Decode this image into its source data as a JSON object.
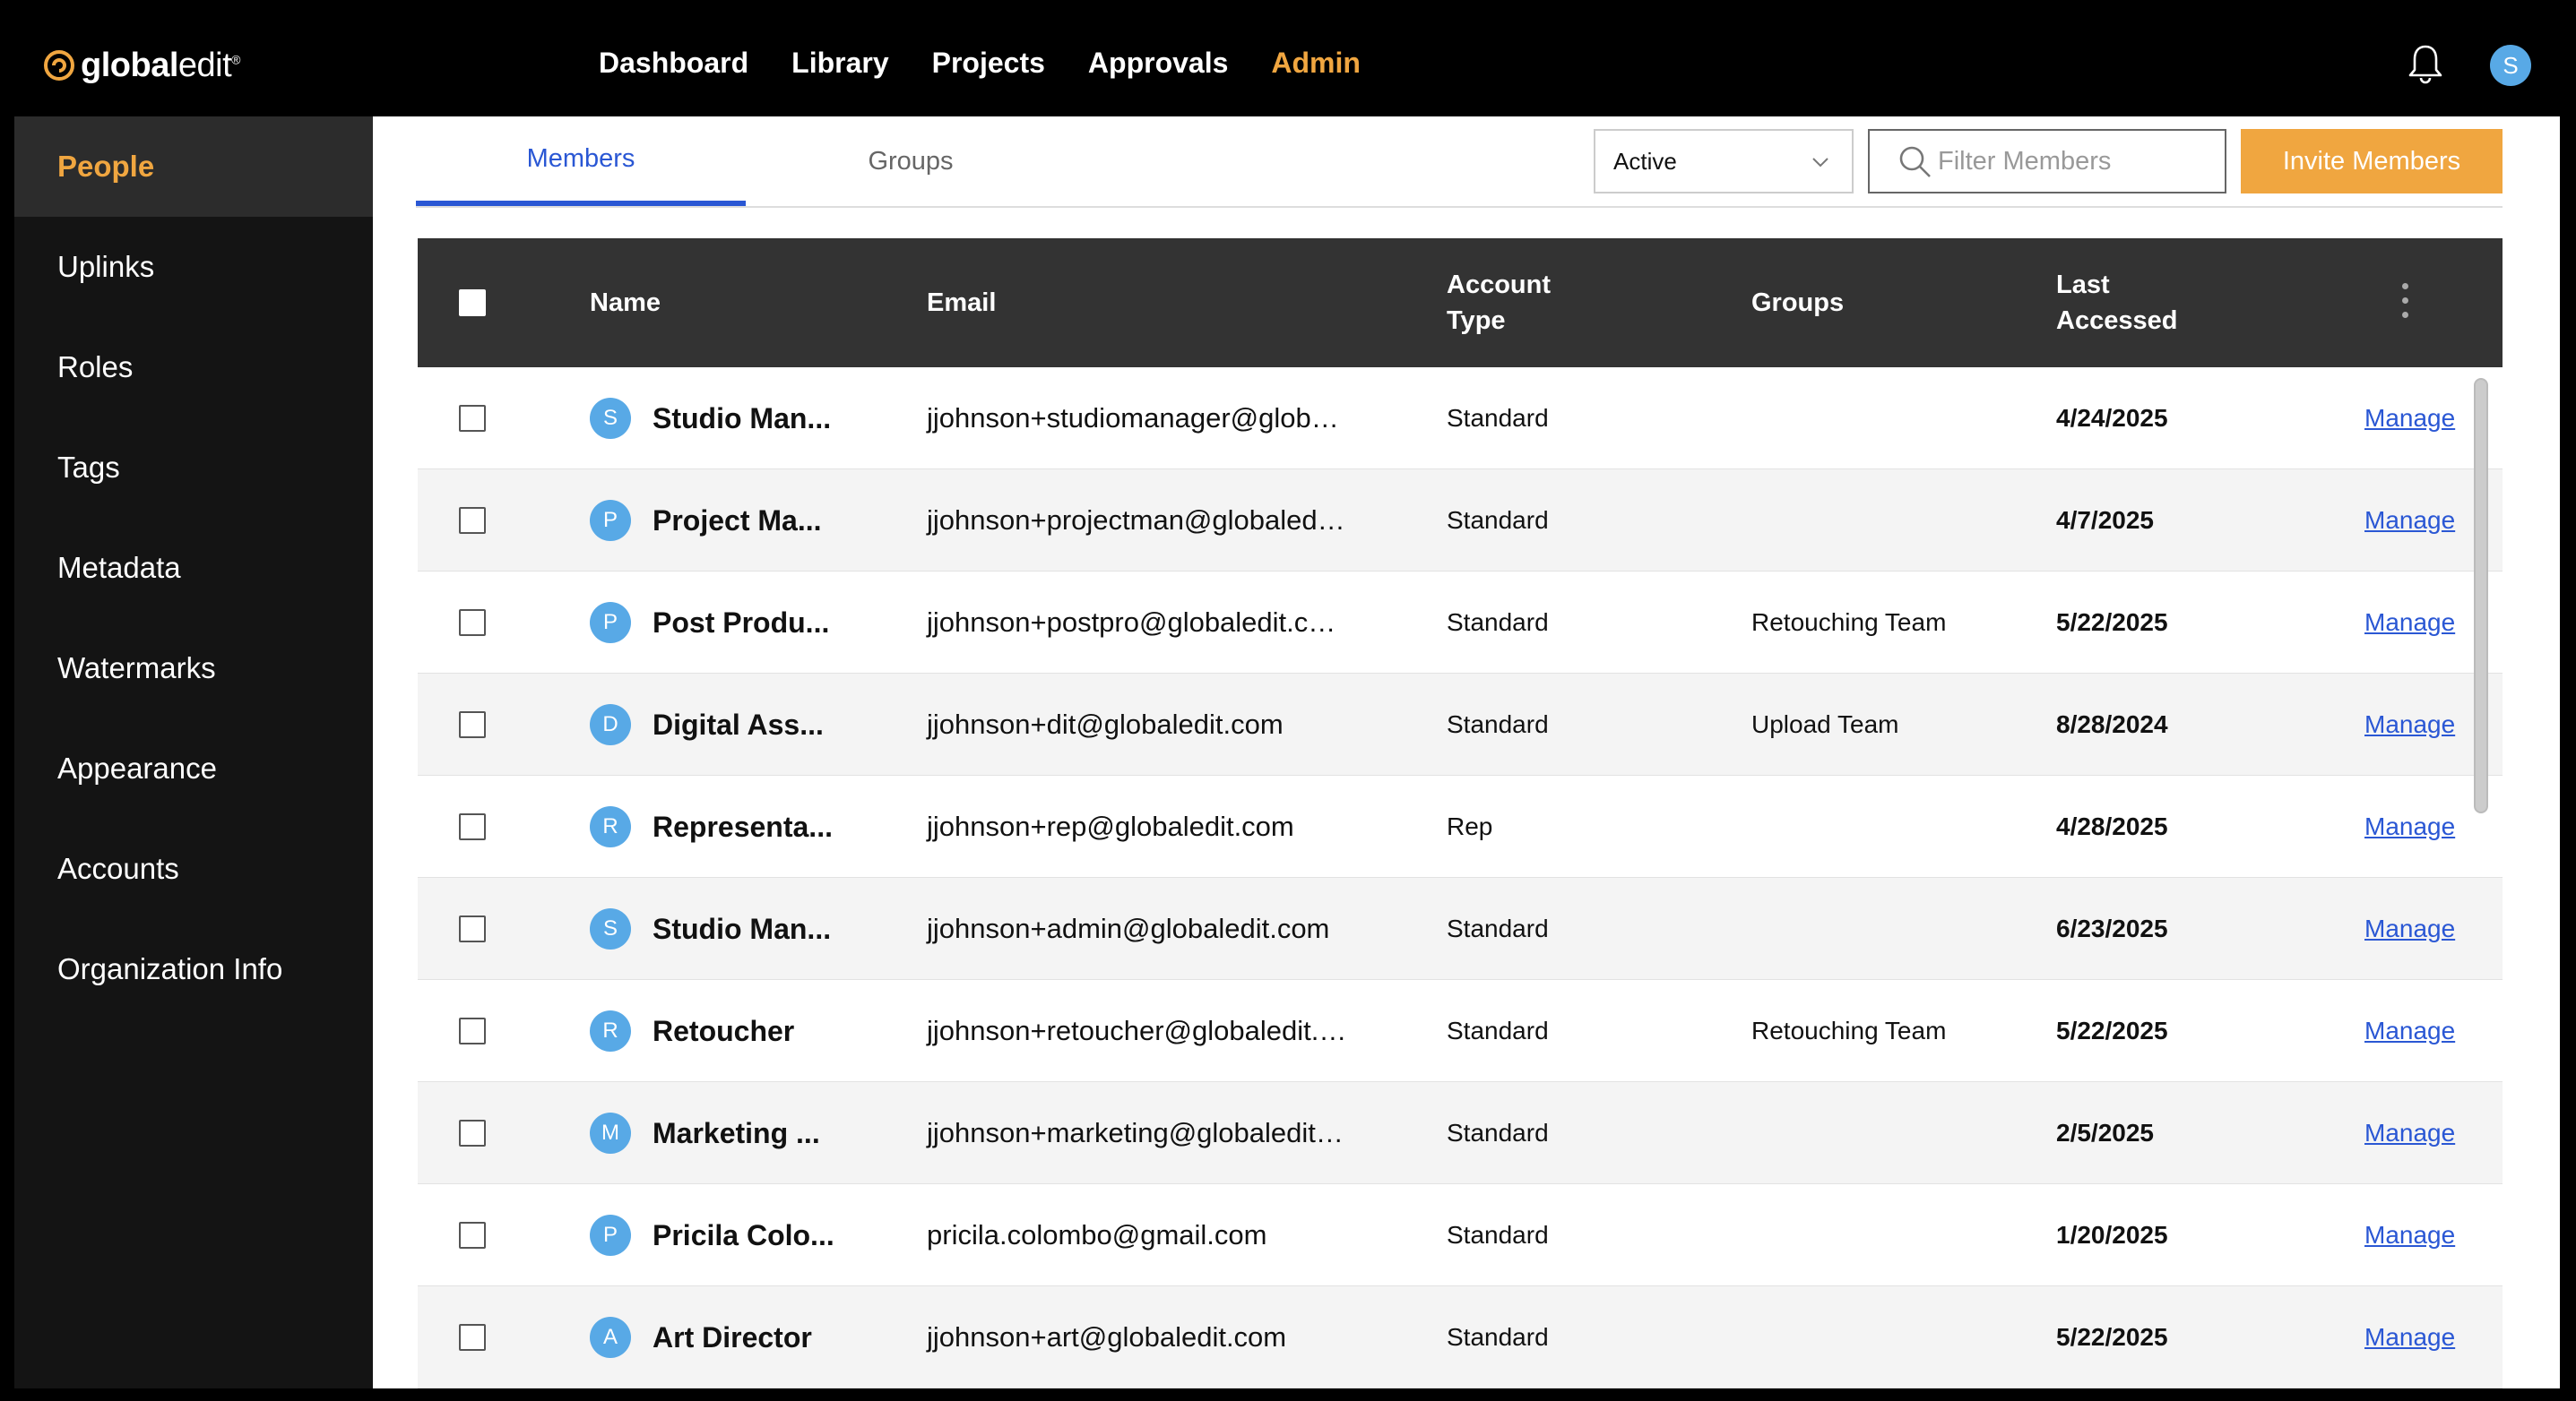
{
  "brand": {
    "bold": "global",
    "light": "edit",
    "mark": "®"
  },
  "nav": [
    {
      "label": "Dashboard"
    },
    {
      "label": "Library"
    },
    {
      "label": "Projects"
    },
    {
      "label": "Approvals"
    },
    {
      "label": "Admin"
    }
  ],
  "user": {
    "initial": "S"
  },
  "sidebar": [
    {
      "label": "People"
    },
    {
      "label": "Uplinks"
    },
    {
      "label": "Roles"
    },
    {
      "label": "Tags"
    },
    {
      "label": "Metadata"
    },
    {
      "label": "Watermarks"
    },
    {
      "label": "Appearance"
    },
    {
      "label": "Accounts"
    },
    {
      "label": "Organization Info"
    }
  ],
  "tabs": {
    "members": "Members",
    "groups": "Groups"
  },
  "status_select": {
    "value": "Active"
  },
  "filter": {
    "placeholder": "Filter Members",
    "value": ""
  },
  "invite_label": "Invite Members",
  "columns": {
    "name": "Name",
    "email": "Email",
    "type_line1": "Account",
    "type_line2": "Type",
    "groups": "Groups",
    "last_line1": "Last",
    "last_line2": "Accessed"
  },
  "rows": [
    {
      "initial": "S",
      "name": "Studio Man...",
      "email": "jjohnson+studiomanager@glob…",
      "type": "Standard",
      "groups": "",
      "last": "4/24/2025",
      "action": "Manage"
    },
    {
      "initial": "P",
      "name": "Project Ma...",
      "email": "jjohnson+projectman@globaled…",
      "type": "Standard",
      "groups": "",
      "last": "4/7/2025",
      "action": "Manage"
    },
    {
      "initial": "P",
      "name": "Post Produ...",
      "email": "jjohnson+postpro@globaledit.c…",
      "type": "Standard",
      "groups": "Retouching Team",
      "last": "5/22/2025",
      "action": "Manage"
    },
    {
      "initial": "D",
      "name": "Digital Ass...",
      "email": "jjohnson+dit@globaledit.com",
      "type": "Standard",
      "groups": "Upload Team",
      "last": "8/28/2024",
      "action": "Manage"
    },
    {
      "initial": "R",
      "name": "Representa...",
      "email": "jjohnson+rep@globaledit.com",
      "type": "Rep",
      "groups": "",
      "last": "4/28/2025",
      "action": "Manage"
    },
    {
      "initial": "S",
      "name": "Studio Man...",
      "email": "jjohnson+admin@globaledit.com",
      "type": "Standard",
      "groups": "",
      "last": "6/23/2025",
      "action": "Manage"
    },
    {
      "initial": "R",
      "name": "Retoucher",
      "email": "jjohnson+retoucher@globaledit.…",
      "type": "Standard",
      "groups": "Retouching Team",
      "last": "5/22/2025",
      "action": "Manage"
    },
    {
      "initial": "M",
      "name": "Marketing ...",
      "email": "jjohnson+marketing@globaledit…",
      "type": "Standard",
      "groups": "",
      "last": "2/5/2025",
      "action": "Manage"
    },
    {
      "initial": "P",
      "name": "Pricila Colo...",
      "email": "pricila.colombo@gmail.com",
      "type": "Standard",
      "groups": "",
      "last": "1/20/2025",
      "action": "Manage"
    },
    {
      "initial": "A",
      "name": "Art Director",
      "email": "jjohnson+art@globaledit.com",
      "type": "Standard",
      "groups": "",
      "last": "5/22/2025",
      "action": "Manage"
    }
  ],
  "colors": {
    "accent": "#f0a640",
    "link": "#2a57d4",
    "avatar": "#58a9e6"
  }
}
